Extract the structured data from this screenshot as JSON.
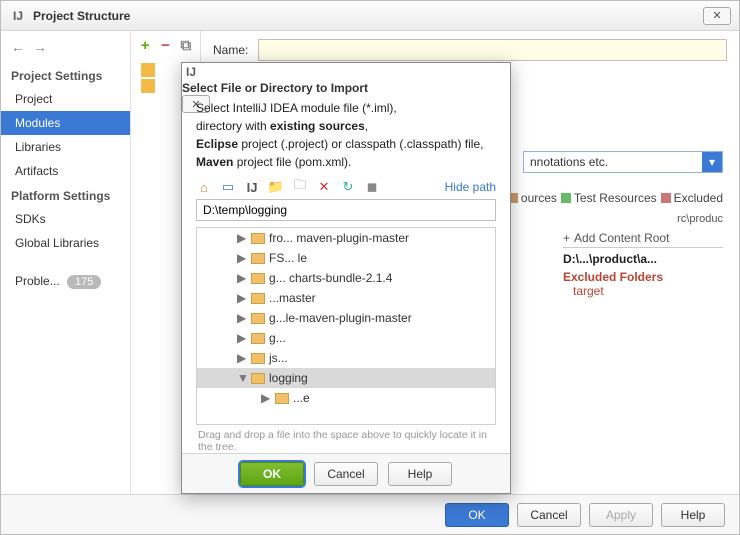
{
  "main": {
    "title": "Project Structure",
    "close_glyph": "✕",
    "nav_back": "←",
    "nav_fwd": "→",
    "section1": "Project Settings",
    "items1": [
      "Project",
      "Modules",
      "Libraries",
      "Artifacts"
    ],
    "section2": "Platform Settings",
    "items2": [
      "SDKs",
      "Global Libraries"
    ],
    "problems_label": "Proble...",
    "problems_count": "175",
    "name_label": "Name:",
    "name_value": "",
    "dropdown_text": "nnotations etc.",
    "tabs": {
      "resources": "ources",
      "testres": "Test Resources",
      "excluded": "Excluded"
    },
    "src_path": "rc\\produc",
    "content_root_hdr": "Add Content Root",
    "content_root_plus": "+",
    "content_path": "D:\\...\\product\\a...",
    "excluded_folders": "Excluded Folders",
    "excluded_value": "target",
    "footer": {
      "ok": "OK",
      "cancel": "Cancel",
      "apply": "Apply",
      "help": "Help"
    }
  },
  "dialog": {
    "title": "Select File or Directory to Import",
    "instr_lines": {
      "l1a": "Select IntelliJ IDEA module file (*.iml),",
      "l2a": "directory with ",
      "l2b": "existing sources",
      "l2c": ",",
      "l3a": "Eclipse",
      "l3b": " project (.project) or classpath (.classpath) file,",
      "l4a": "Maven",
      "l4b": " project file (pom.xml)."
    },
    "hide_path": "Hide path",
    "path_value": "D:\\temp\\logging",
    "tree": [
      {
        "arrow": "▶",
        "label": "fro... maven-plugin-master"
      },
      {
        "arrow": "▶",
        "label": "FS... le"
      },
      {
        "arrow": "▶",
        "label": "g... charts-bundle-2.1.4"
      },
      {
        "arrow": "▶",
        "label": "...master"
      },
      {
        "arrow": "▶",
        "label": "g...le-maven-plugin-master"
      },
      {
        "arrow": "▶",
        "label": "g..."
      },
      {
        "arrow": "▶",
        "label": "js..."
      },
      {
        "arrow": "▼",
        "label": "logging",
        "sel": true
      },
      {
        "arrow": "▶",
        "label": "...e",
        "child": true
      }
    ],
    "hint": "Drag and drop a file into the space above to quickly locate it in the tree.",
    "footer": {
      "ok": "OK",
      "cancel": "Cancel",
      "help": "Help"
    }
  }
}
